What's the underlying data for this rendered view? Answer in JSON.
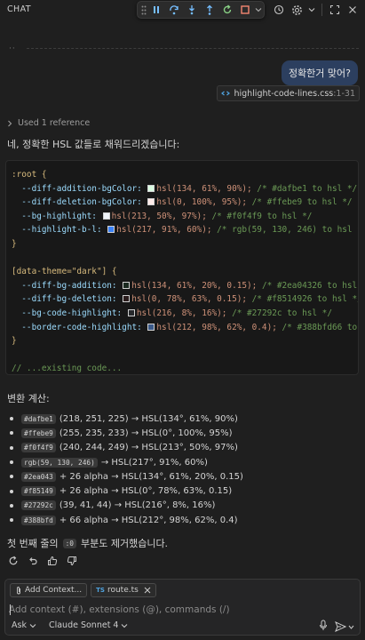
{
  "header": {
    "title": "CHAT",
    "debug_toolbar": [
      "drag-handle",
      "pause",
      "step-over",
      "step-into",
      "step-out",
      "restart",
      "stop",
      "chevron-down"
    ],
    "actions": [
      "history",
      "settings",
      "chevron-down",
      "new-window",
      "close"
    ]
  },
  "user_message": {
    "text": "정확한거 맞어?",
    "reference": {
      "file": "highlight-code-lines.css",
      "range": ":1-31"
    }
  },
  "used_references": "Used 1 reference",
  "response_intro": "네, 정확한 HSL 값들로 채워드리겠습니다:",
  "code_lines": [
    [
      {
        "t": ":root {",
        "c": "sel"
      }
    ],
    [
      {
        "t": "  --diff-addition-bgColor: ",
        "c": "prop"
      },
      {
        "sw": "#dafbe1"
      },
      {
        "t": "hsl(134, 61%, 90%); ",
        "c": "val"
      },
      {
        "t": "/* #dafbe1 to hsl */",
        "c": "cmt"
      }
    ],
    [
      {
        "t": "  --diff-deletion-bgColor: ",
        "c": "prop"
      },
      {
        "sw": "#ffebe9"
      },
      {
        "t": "hsl(0, 100%, 95%); ",
        "c": "val"
      },
      {
        "t": "/* #ffebe9 to hsl */",
        "c": "cmt"
      }
    ],
    [
      {
        "t": "  --bg-highlight: ",
        "c": "prop"
      },
      {
        "sw": "#f0f4f9"
      },
      {
        "t": "hsl(213, 50%, 97%); ",
        "c": "val"
      },
      {
        "t": "/* #f0f4f9 to hsl */",
        "c": "cmt"
      }
    ],
    [
      {
        "t": "  --highlight-b-l: ",
        "c": "prop"
      },
      {
        "sw": "#3b82f6"
      },
      {
        "t": "hsl(217, 91%, 60%); ",
        "c": "val"
      },
      {
        "t": "/* rgb(59, 130, 246) to hsl */",
        "c": "cmt"
      }
    ],
    [
      {
        "t": "}",
        "c": "sel"
      }
    ],
    [
      {
        "t": "",
        "c": "sel"
      }
    ],
    [
      {
        "t": "[data-theme=\"dark\"] {",
        "c": "sel"
      }
    ],
    [
      {
        "t": "  --diff-bg-addition: ",
        "c": "prop"
      },
      {
        "sw": "#1b2a20"
      },
      {
        "t": "hsl(134, 61%, 20%, 0.15); ",
        "c": "val"
      },
      {
        "t": "/* #2ea04326 to hsl */",
        "c": "cmt"
      }
    ],
    [
      {
        "t": "  --diff-bg-deletion: ",
        "c": "prop"
      },
      {
        "sw": "#2a1c1c"
      },
      {
        "t": "hsl(0, 78%, 63%, 0.15); ",
        "c": "val"
      },
      {
        "t": "/* #f8514926 to hsl */",
        "c": "cmt"
      }
    ],
    [
      {
        "t": "  --bg-code-highlight: ",
        "c": "prop"
      },
      {
        "sw": "#27292c"
      },
      {
        "t": "hsl(216, 8%, 16%); ",
        "c": "val"
      },
      {
        "t": "/* #27292c to hsl */",
        "c": "cmt"
      }
    ],
    [
      {
        "t": "  --border-code-highlight: ",
        "c": "prop"
      },
      {
        "sw": "#3b5a8a"
      },
      {
        "t": "hsl(212, 98%, 62%, 0.4); ",
        "c": "val"
      },
      {
        "t": "/* #388bfd66 to hsl",
        "c": "cmt"
      }
    ],
    [
      {
        "t": "}",
        "c": "sel"
      }
    ],
    [
      {
        "t": "",
        "c": "sel"
      }
    ],
    [
      {
        "t": "// ...existing code...",
        "c": "cmt"
      }
    ]
  ],
  "conversion_title": "변환 계산:",
  "conversions": [
    {
      "tag": "#dafbe1",
      "text": "(218, 251, 225) → HSL(134°, 61%, 90%)"
    },
    {
      "tag": "#ffebe9",
      "text": "(255, 235, 233) → HSL(0°, 100%, 95%)"
    },
    {
      "tag": "#f0f4f9",
      "text": "(240, 244, 249) → HSL(213°, 50%, 97%)"
    },
    {
      "tag": "rgb(59, 130, 246)",
      "text": "→ HSL(217°, 91%, 60%)"
    },
    {
      "tag": "#2ea043",
      "text": "+ 26 alpha → HSL(134°, 61%, 20%, 0.15)"
    },
    {
      "tag": "#f85149",
      "text": "+ 26 alpha → HSL(0°, 78%, 63%, 0.15)"
    },
    {
      "tag": "#27292c",
      "text": "(39, 41, 44) → HSL(216°, 8%, 16%)"
    },
    {
      "tag": "#388bfd",
      "text": "+ 66 alpha → HSL(212°, 98%, 62%, 0.4)"
    }
  ],
  "closing": {
    "before": "첫 번째 줄의",
    "tag": ":0",
    "after": "부분도 제거했습니다."
  },
  "feedback": [
    "retry",
    "undo",
    "thumbs-up",
    "thumbs-down"
  ],
  "input": {
    "chips": {
      "add_context": "Add Context...",
      "file_label": "route.ts",
      "file_type": "TS"
    },
    "placeholder": "Add context (#), extensions (@), commands (/)",
    "mode": "Ask",
    "model": "Claude Sonnet 4"
  },
  "colors": {
    "background": "#1f1f1f",
    "user_bubble": "#2c3f5f",
    "accent": "#4fa3e0"
  }
}
